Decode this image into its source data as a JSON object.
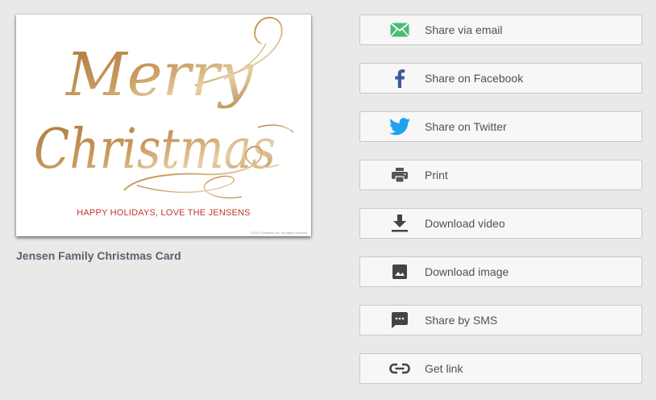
{
  "card": {
    "message": "HAPPY HOLIDAYS, LOVE THE JENSENS",
    "lettering_line1": "Merry",
    "lettering_line2": "Christmas",
    "fineprint": "©2019 Smilebox Inc. All rights reserved.",
    "title": "Jensen Family Christmas Card",
    "colors": {
      "gold": "#b9894a",
      "gold_light": "#e2c79a",
      "message_red": "#c0392b"
    }
  },
  "actions": [
    {
      "id": "email",
      "label": "Share via email",
      "icon": "envelope-icon",
      "color": "#4cbb73"
    },
    {
      "id": "facebook",
      "label": "Share on Facebook",
      "icon": "facebook-icon",
      "color": "#3b5998"
    },
    {
      "id": "twitter",
      "label": "Share on Twitter",
      "icon": "twitter-icon",
      "color": "#1da1f2"
    },
    {
      "id": "print",
      "label": "Print",
      "icon": "printer-icon",
      "color": "#555555"
    },
    {
      "id": "download-video",
      "label": "Download video",
      "icon": "download-icon",
      "color": "#444444"
    },
    {
      "id": "download-image",
      "label": "Download image",
      "icon": "image-icon",
      "color": "#444444"
    },
    {
      "id": "sms",
      "label": "Share by SMS",
      "icon": "sms-icon",
      "color": "#444444"
    },
    {
      "id": "link",
      "label": "Get link",
      "icon": "link-icon",
      "color": "#444444"
    }
  ]
}
